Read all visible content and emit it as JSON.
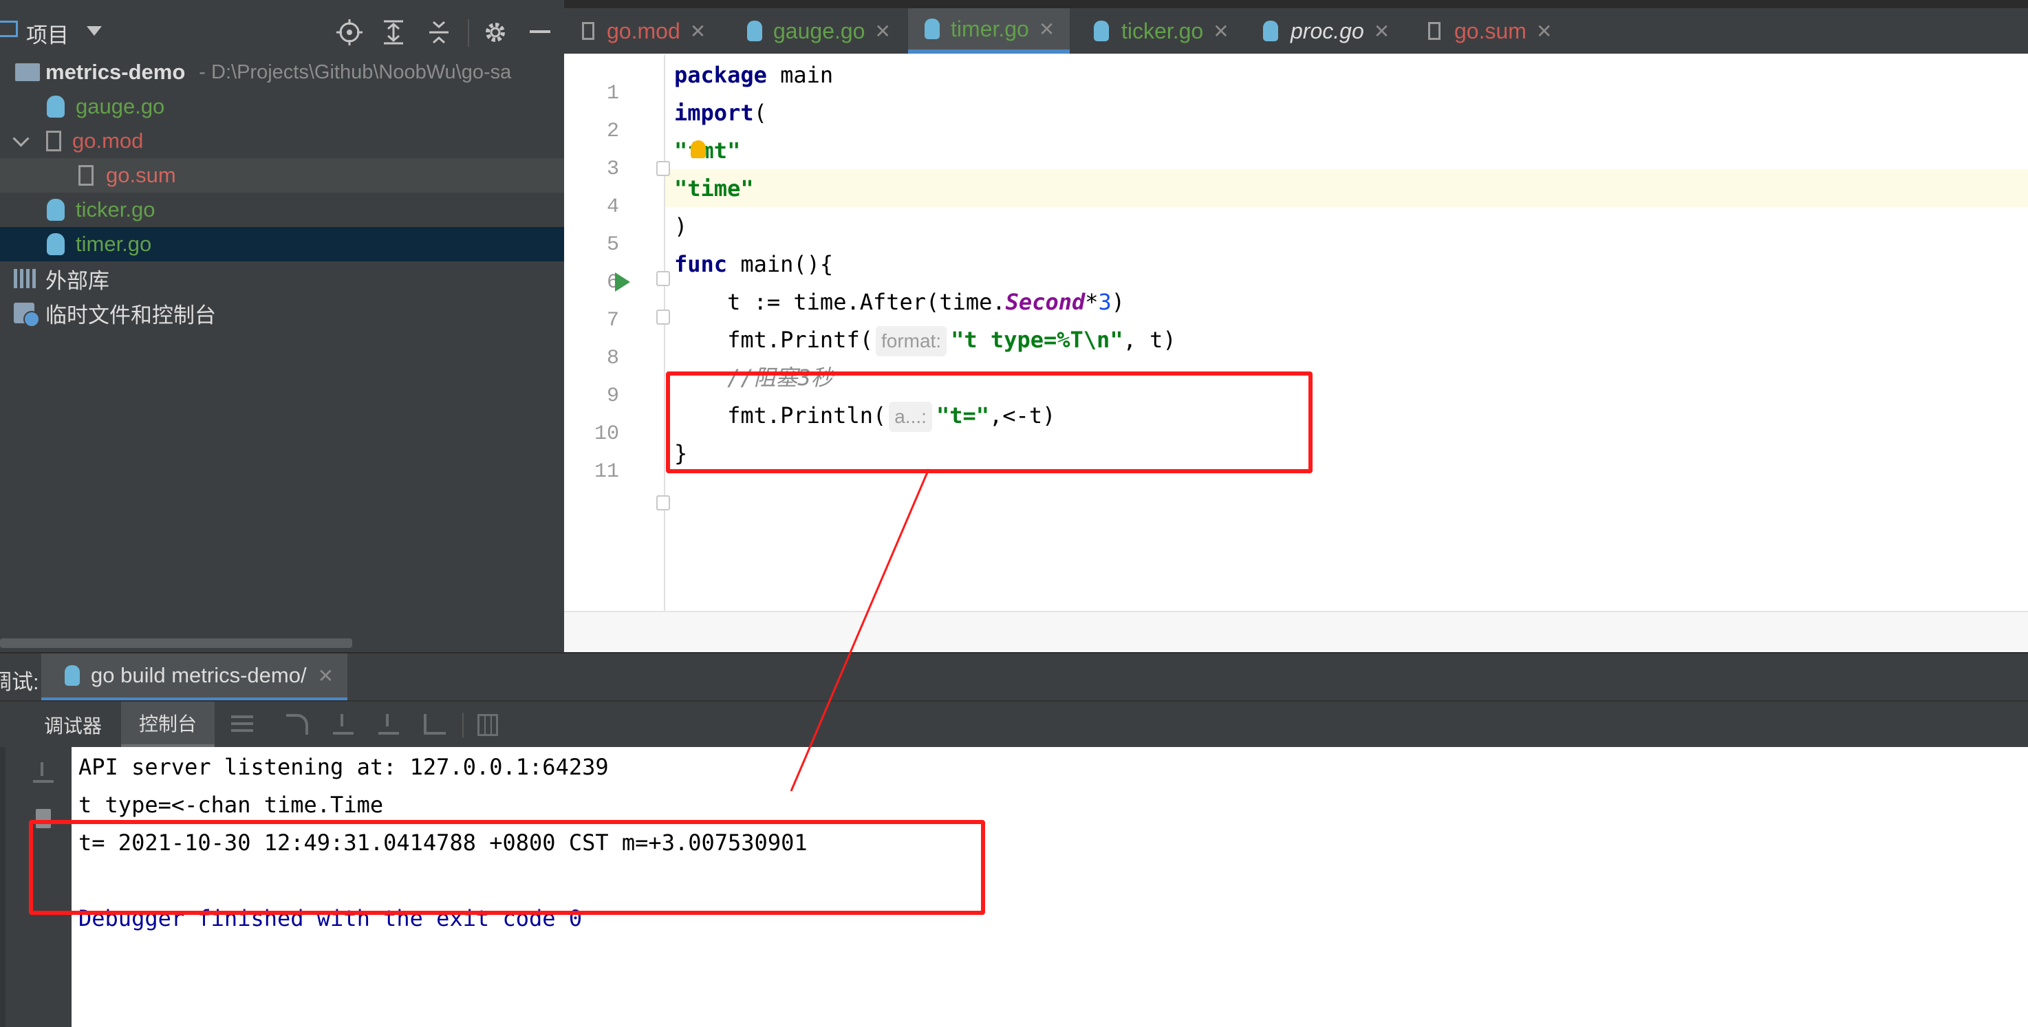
{
  "project": {
    "header_label": "项目",
    "root_name": "metrics-demo",
    "root_path": "- D:\\Projects\\Github\\NoobWu\\go-sa",
    "files": [
      {
        "name": "gauge.go"
      },
      {
        "name": "go.mod"
      },
      {
        "name": "go.sum"
      },
      {
        "name": "ticker.go"
      },
      {
        "name": "timer.go"
      }
    ],
    "external_libs": "外部库",
    "scratches": "临时文件和控制台"
  },
  "tabs": [
    {
      "label": "go.mod",
      "color": "#cf5b56"
    },
    {
      "label": "gauge.go",
      "color": "#62a04a"
    },
    {
      "label": "timer.go",
      "color": "#62a04a"
    },
    {
      "label": "ticker.go",
      "color": "#62a04a"
    },
    {
      "label": "proc.go",
      "color": "#bbbbbb"
    },
    {
      "label": "go.sum",
      "color": "#cf5b56"
    }
  ],
  "editor": {
    "line_numbers": [
      "1",
      "2",
      "3",
      "4",
      "5",
      "6",
      "7",
      "8",
      "9",
      "10",
      "11"
    ],
    "l1_kw": "package",
    "l1_rest": " main",
    "l2_kw": "import",
    "l2_rest": "(",
    "l3_str": "\"fmt\"",
    "l4_str": "\"time\"",
    "l5": ")",
    "l6_kw": "func",
    "l6_rest": " main(){",
    "l7_a": "    t := time.After(time.",
    "l7_const": "Second",
    "l7_b": "*",
    "l7_num": "3",
    "l7_c": ")",
    "l8_a": "    fmt.Printf(",
    "l8_hint": "format:",
    "l8_str": "\"t type=%T\\n\"",
    "l8_b": ", t)",
    "l9_cmt": "    //阻塞3秒",
    "l10_a": "    fmt.Println(",
    "l10_hint": "a...:",
    "l10_str": "\"t=\"",
    "l10_b": ",<-t)",
    "l11": "}"
  },
  "debug": {
    "prefix": "调试:",
    "run_tab": "go build metrics-demo/",
    "tab_debugger": "调试器",
    "tab_console": "控制台"
  },
  "console": {
    "line1": "API server listening at: 127.0.0.1:64239",
    "line2": "t type=<-chan time.Time",
    "line3": "t= 2021-10-30 12:49:31.0414788 +0800 CST m=+3.007530901",
    "line4": "Debugger finished with the exit code 0"
  },
  "colors": {
    "annotation": "#ff1a1a",
    "selection": "#0d293e",
    "active_tab_underline": "#4a88c7",
    "current_line": "#fdfbe6"
  }
}
